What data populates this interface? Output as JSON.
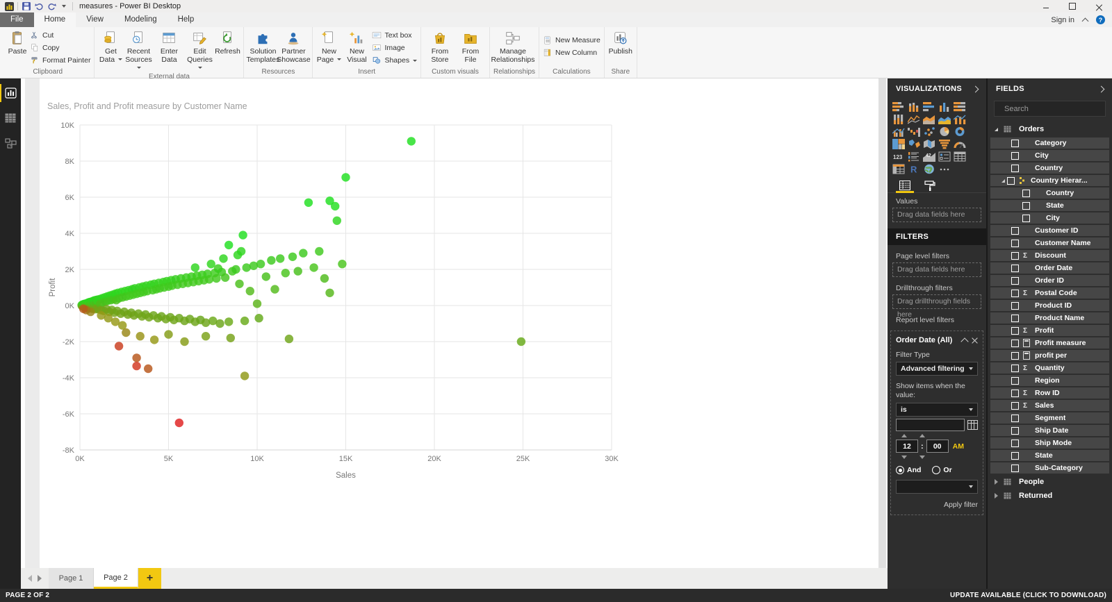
{
  "titlebar": {
    "title": "measures - Power BI Desktop"
  },
  "menu": {
    "tabs": [
      {
        "label": "File"
      },
      {
        "label": "Home"
      },
      {
        "label": "View"
      },
      {
        "label": "Modeling"
      },
      {
        "label": "Help"
      }
    ],
    "active": "Home",
    "sign_in": "Sign in"
  },
  "ribbon": {
    "groups": [
      {
        "label": "Clipboard",
        "big": [
          {
            "label": "Paste",
            "icon": "paste"
          }
        ],
        "small": [
          {
            "label": "Cut",
            "icon": "cut"
          },
          {
            "label": "Copy",
            "icon": "copy"
          },
          {
            "label": "Format Painter",
            "icon": "painter"
          }
        ]
      },
      {
        "label": "External data",
        "big": [
          {
            "label": "Get Data",
            "icon": "get-data",
            "dd": true
          },
          {
            "label": "Recent Sources",
            "icon": "recent",
            "dd": true
          },
          {
            "label": "Enter Data",
            "icon": "enter-data"
          },
          {
            "label": "Edit Queries",
            "icon": "edit-queries",
            "dd": true
          },
          {
            "label": "Refresh",
            "icon": "refresh"
          }
        ]
      },
      {
        "label": "Resources",
        "big": [
          {
            "label": "Solution Templates",
            "icon": "solution"
          },
          {
            "label": "Partner Showcase",
            "icon": "partner"
          }
        ]
      },
      {
        "label": "Insert",
        "big": [
          {
            "label": "New Page",
            "icon": "new-page",
            "dd": true
          },
          {
            "label": "New Visual",
            "icon": "new-visual"
          }
        ],
        "small": [
          {
            "label": "Text box",
            "icon": "textbox"
          },
          {
            "label": "Image",
            "icon": "image"
          },
          {
            "label": "Shapes",
            "icon": "shapes",
            "dd": true
          }
        ]
      },
      {
        "label": "Custom visuals",
        "big": [
          {
            "label": "From Store",
            "icon": "store"
          },
          {
            "label": "From File",
            "icon": "file"
          }
        ]
      },
      {
        "label": "Relationships",
        "big": [
          {
            "label": "Manage Relationships",
            "icon": "manage-rel",
            "wide": true
          }
        ]
      },
      {
        "label": "Calculations",
        "small": [
          {
            "label": "New Measure",
            "icon": "new-measure"
          },
          {
            "label": "New Column",
            "icon": "new-column"
          }
        ]
      },
      {
        "label": "Share",
        "big": [
          {
            "label": "Publish",
            "icon": "publish"
          }
        ]
      }
    ]
  },
  "left_nav": {
    "items": [
      "report-view",
      "data-view",
      "model-view"
    ],
    "active": "report-view"
  },
  "chart_data": {
    "type": "scatter",
    "title": "Sales, Profit and Profit measure by Customer Name",
    "xlabel": "Sales",
    "ylabel": "Profit",
    "xlim": [
      0,
      30
    ],
    "ylim": [
      -8,
      10
    ],
    "x_ticks": [
      {
        "v": 0,
        "label": "0K"
      },
      {
        "v": 5,
        "label": "5K"
      },
      {
        "v": 10,
        "label": "10K"
      },
      {
        "v": 15,
        "label": "15K"
      },
      {
        "v": 20,
        "label": "20K"
      },
      {
        "v": 25,
        "label": "25K"
      },
      {
        "v": 30,
        "label": "30K"
      }
    ],
    "y_ticks": [
      {
        "v": 10,
        "label": "10K"
      },
      {
        "v": 8,
        "label": "8K"
      },
      {
        "v": 6,
        "label": "6K"
      },
      {
        "v": 4,
        "label": "4K"
      },
      {
        "v": 2,
        "label": "2K"
      },
      {
        "v": 0,
        "label": "0K"
      },
      {
        "v": -2,
        "label": "-2K"
      },
      {
        "v": -4,
        "label": "-4K"
      },
      {
        "v": -6,
        "label": "-6K"
      },
      {
        "v": -8,
        "label": "-8K"
      }
    ],
    "color_rule": "color encodes Profit measure (profit/sales ratio): red negative to green positive",
    "points": [
      [
        0.1,
        0.02
      ],
      [
        0.12,
        -0.03
      ],
      [
        0.15,
        0.05
      ],
      [
        0.18,
        0.01
      ],
      [
        0.2,
        -0.06
      ],
      [
        0.22,
        0.08
      ],
      [
        0.25,
        0.03
      ],
      [
        0.28,
        -0.1
      ],
      [
        0.3,
        0.1
      ],
      [
        0.32,
        0.04
      ],
      [
        0.35,
        -0.05
      ],
      [
        0.38,
        0.12
      ],
      [
        0.4,
        0.02
      ],
      [
        0.42,
        -0.12
      ],
      [
        0.45,
        0.15
      ],
      [
        0.48,
        0.06
      ],
      [
        0.5,
        -0.08
      ],
      [
        0.52,
        0.18
      ],
      [
        0.55,
        0.1
      ],
      [
        0.58,
        -0.15
      ],
      [
        0.6,
        0.2
      ],
      [
        0.62,
        0.05
      ],
      [
        0.65,
        -0.1
      ],
      [
        0.68,
        0.22
      ],
      [
        0.7,
        0.12
      ],
      [
        0.72,
        -0.18
      ],
      [
        0.75,
        0.25
      ],
      [
        0.78,
        0.08
      ],
      [
        0.8,
        -0.12
      ],
      [
        0.82,
        0.28
      ],
      [
        0.85,
        0.15
      ],
      [
        0.88,
        -0.2
      ],
      [
        0.9,
        0.3
      ],
      [
        0.92,
        0.1
      ],
      [
        0.95,
        -0.15
      ],
      [
        0.98,
        0.32
      ],
      [
        1.0,
        0.25
      ],
      [
        1.05,
        -0.2
      ],
      [
        1.1,
        0.35
      ],
      [
        1.15,
        0.1
      ],
      [
        1.2,
        -0.25
      ],
      [
        1.25,
        0.4
      ],
      [
        1.3,
        0.18
      ],
      [
        1.35,
        -0.3
      ],
      [
        1.4,
        0.45
      ],
      [
        1.45,
        0.22
      ],
      [
        1.5,
        -0.2
      ],
      [
        1.55,
        0.5
      ],
      [
        1.6,
        0.28
      ],
      [
        1.65,
        -0.35
      ],
      [
        1.7,
        0.55
      ],
      [
        1.75,
        0.3
      ],
      [
        1.8,
        -0.25
      ],
      [
        1.85,
        0.6
      ],
      [
        1.9,
        0.35
      ],
      [
        1.95,
        -0.4
      ],
      [
        2.0,
        0.65
      ],
      [
        2.05,
        0.3
      ],
      [
        2.1,
        -0.3
      ],
      [
        2.15,
        0.7
      ],
      [
        2.2,
        0.4
      ],
      [
        2.3,
        -0.45
      ],
      [
        2.35,
        0.75
      ],
      [
        2.4,
        0.45
      ],
      [
        2.5,
        -0.35
      ],
      [
        2.55,
        0.8
      ],
      [
        2.6,
        0.5
      ],
      [
        2.7,
        -0.5
      ],
      [
        2.75,
        0.85
      ],
      [
        2.8,
        0.55
      ],
      [
        2.9,
        -0.4
      ],
      [
        2.95,
        0.9
      ],
      [
        3.0,
        0.6
      ],
      [
        3.05,
        -0.55
      ],
      [
        3.1,
        0.95
      ],
      [
        3.2,
        0.65
      ],
      [
        3.3,
        -0.45
      ],
      [
        3.35,
        1.0
      ],
      [
        3.4,
        0.7
      ],
      [
        3.5,
        -0.6
      ],
      [
        3.55,
        1.05
      ],
      [
        3.6,
        0.75
      ],
      [
        3.7,
        -0.5
      ],
      [
        3.75,
        1.1
      ],
      [
        3.8,
        0.8
      ],
      [
        3.9,
        -0.65
      ],
      [
        4.0,
        1.15
      ],
      [
        4.1,
        0.85
      ],
      [
        4.15,
        -0.55
      ],
      [
        4.2,
        1.2
      ],
      [
        4.3,
        0.9
      ],
      [
        4.4,
        -0.7
      ],
      [
        4.45,
        1.25
      ],
      [
        4.5,
        0.95
      ],
      [
        4.6,
        -0.6
      ],
      [
        4.7,
        1.3
      ],
      [
        4.75,
        1.0
      ],
      [
        4.85,
        -0.75
      ],
      [
        4.9,
        1.35
      ],
      [
        5.0,
        1.05
      ],
      [
        5.1,
        -0.65
      ],
      [
        5.15,
        1.4
      ],
      [
        5.2,
        1.1
      ],
      [
        5.3,
        -0.8
      ],
      [
        5.4,
        1.45
      ],
      [
        5.5,
        1.15
      ],
      [
        5.6,
        -0.7
      ],
      [
        5.7,
        1.5
      ],
      [
        5.8,
        1.2
      ],
      [
        5.9,
        -0.85
      ],
      [
        6.0,
        1.55
      ],
      [
        6.1,
        1.25
      ],
      [
        6.2,
        -0.75
      ],
      [
        6.3,
        1.6
      ],
      [
        6.4,
        1.3
      ],
      [
        6.5,
        -0.9
      ],
      [
        6.6,
        1.65
      ],
      [
        6.7,
        1.35
      ],
      [
        6.8,
        -0.8
      ],
      [
        6.9,
        1.7
      ],
      [
        7.0,
        1.4
      ],
      [
        7.1,
        -0.95
      ],
      [
        7.2,
        1.75
      ],
      [
        7.3,
        1.45
      ],
      [
        7.5,
        -0.85
      ],
      [
        7.6,
        1.8
      ],
      [
        7.7,
        1.5
      ],
      [
        7.9,
        -1.0
      ],
      [
        8.0,
        1.85
      ],
      [
        8.2,
        1.55
      ],
      [
        8.4,
        -0.9
      ],
      [
        6.5,
        2.1
      ],
      [
        7.4,
        2.3
      ],
      [
        8.1,
        2.6
      ],
      [
        8.9,
        2.8
      ],
      [
        7.8,
        2.05
      ],
      [
        9.1,
        3.0
      ],
      [
        8.4,
        3.35
      ],
      [
        8.6,
        1.9
      ],
      [
        8.8,
        2.0
      ],
      [
        9.0,
        1.2
      ],
      [
        9.2,
        3.9
      ],
      [
        9.4,
        2.1
      ],
      [
        9.6,
        0.8
      ],
      [
        9.8,
        2.2
      ],
      [
        10.0,
        0.1
      ],
      [
        10.2,
        2.3
      ],
      [
        10.5,
        1.6
      ],
      [
        10.8,
        2.5
      ],
      [
        11.0,
        0.9
      ],
      [
        11.3,
        2.6
      ],
      [
        11.6,
        1.8
      ],
      [
        11.8,
        -1.85
      ],
      [
        12.0,
        2.7
      ],
      [
        12.3,
        1.9
      ],
      [
        12.6,
        2.9
      ],
      [
        12.9,
        5.7
      ],
      [
        13.2,
        2.1
      ],
      [
        13.5,
        3.0
      ],
      [
        13.8,
        1.5
      ],
      [
        14.1,
        5.8
      ],
      [
        14.1,
        0.7
      ],
      [
        14.4,
        5.5
      ],
      [
        14.5,
        4.7
      ],
      [
        14.8,
        2.3
      ],
      [
        15.0,
        7.1
      ],
      [
        18.7,
        9.1
      ],
      [
        24.9,
        -2.0
      ],
      [
        2.6,
        -1.5
      ],
      [
        3.4,
        -1.7
      ],
      [
        4.2,
        -1.9
      ],
      [
        5.0,
        -1.6
      ],
      [
        5.9,
        -2.0
      ],
      [
        7.1,
        -1.7
      ],
      [
        8.5,
        -1.8
      ],
      [
        9.3,
        -0.85
      ],
      [
        10.1,
        -0.7
      ],
      [
        2.2,
        -2.25
      ],
      [
        3.2,
        -2.9
      ],
      [
        3.2,
        -3.35
      ],
      [
        3.85,
        -3.5
      ],
      [
        9.3,
        -3.9
      ],
      [
        5.6,
        -6.5
      ],
      [
        1.2,
        -0.55
      ],
      [
        1.6,
        -0.7
      ],
      [
        2.0,
        -0.9
      ],
      [
        2.4,
        -1.1
      ],
      [
        0.6,
        -0.35
      ],
      [
        0.35,
        -0.25
      ],
      [
        0.2,
        -0.18
      ]
    ]
  },
  "visualizations_panel": {
    "header": "VISUALIZATIONS",
    "icons": [
      "stacked-bar",
      "stacked-column",
      "clustered-bar",
      "clustered-column",
      "100-stacked-bar",
      "100-stacked-column",
      "line",
      "area",
      "stacked-area",
      "line-stacked-column",
      "line-clustered-column",
      "waterfall",
      "scatter",
      "pie",
      "donut",
      "treemap",
      "map",
      "filled-map",
      "funnel",
      "gauge",
      "card",
      "multi-row-card",
      "kpi",
      "slicer",
      "table",
      "matrix",
      "r-script",
      "arcgis-map",
      "ellipsis"
    ],
    "values_label": "Values",
    "values_hint": "Drag data fields here"
  },
  "filters_panel": {
    "header": "FILTERS",
    "sections": [
      {
        "label": "Page level filters",
        "hint": "Drag data fields here"
      },
      {
        "label": "Drillthrough filters",
        "hint": "Drag drillthrough fields here"
      },
      {
        "label": "Report level filters"
      }
    ],
    "card": {
      "title": "Order Date  (All)",
      "filter_type_label": "Filter Type",
      "filter_type_value": "Advanced filtering",
      "show_items_label": "Show items when the value:",
      "condition_value": "is",
      "date_value": "",
      "time": {
        "hour": "12",
        "separator": ":",
        "minute": "00",
        "meridiem": "AM"
      },
      "logic": {
        "and_label": "And",
        "or_label": "Or",
        "selected": "And"
      },
      "second_condition_value": "",
      "apply_label": "Apply filter"
    }
  },
  "fields_panel": {
    "header": "FIELDS",
    "search_placeholder": "Search",
    "tables": [
      {
        "name": "Orders",
        "expanded": true,
        "fields": [
          {
            "label": "Category"
          },
          {
            "label": "City"
          },
          {
            "label": "Country"
          },
          {
            "label": "Country Hierar...",
            "hier": true,
            "expanded": true
          },
          {
            "label": "Country",
            "child": true
          },
          {
            "label": "State",
            "child": true
          },
          {
            "label": "City",
            "child": true
          },
          {
            "label": "Customer ID"
          },
          {
            "label": "Customer Name"
          },
          {
            "label": "Discount",
            "prefix": "sigma"
          },
          {
            "label": "Order Date"
          },
          {
            "label": "Order ID"
          },
          {
            "label": "Postal Code",
            "prefix": "sigma"
          },
          {
            "label": "Product ID"
          },
          {
            "label": "Product Name"
          },
          {
            "label": "Profit",
            "prefix": "sigma"
          },
          {
            "label": "Profit measure",
            "prefix": "calc"
          },
          {
            "label": "profit per",
            "prefix": "calc"
          },
          {
            "label": "Quantity",
            "prefix": "sigma"
          },
          {
            "label": "Region"
          },
          {
            "label": "Row ID",
            "prefix": "sigma"
          },
          {
            "label": "Sales",
            "prefix": "sigma"
          },
          {
            "label": "Segment"
          },
          {
            "label": "Ship Date"
          },
          {
            "label": "Ship Mode"
          },
          {
            "label": "State"
          },
          {
            "label": "Sub-Category"
          }
        ]
      },
      {
        "name": "People",
        "expanded": false
      },
      {
        "name": "Returned",
        "expanded": false
      }
    ]
  },
  "pages": {
    "tabs": [
      {
        "label": "Page 1"
      },
      {
        "label": "Page 2"
      }
    ],
    "active": "Page 2",
    "add_label": "+"
  },
  "statusbar": {
    "left": "PAGE 2 OF 2",
    "right": "UPDATE AVAILABLE (CLICK TO DOWNLOAD)"
  },
  "colors": {
    "accent": "#F2C811",
    "panel_bg": "#2e2e2e",
    "negative_point": "#df2020",
    "positive_point": "#2fd32f",
    "gridline": "#e6e6e6"
  }
}
